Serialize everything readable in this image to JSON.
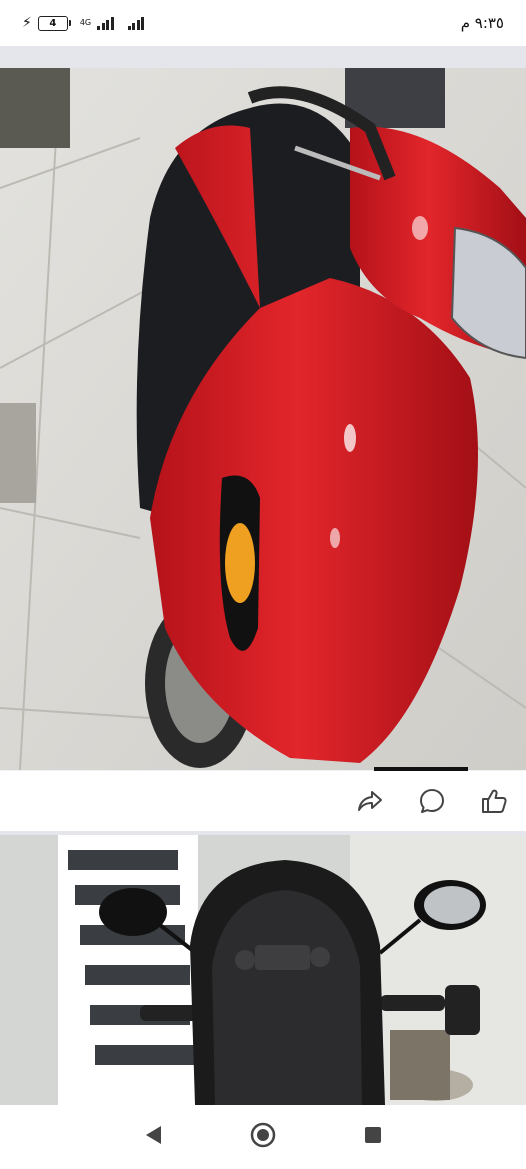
{
  "status_bar": {
    "time": "٩:٣٥ م",
    "battery_level": "4",
    "network": "4G"
  },
  "post": {
    "photos": [
      {
        "description_icon": "red-scooter-photo"
      },
      {
        "description_icon": "scooter-seat-photo"
      }
    ],
    "actions": [
      {
        "name": "share",
        "icon": "share-icon"
      },
      {
        "name": "comment",
        "icon": "comment-icon"
      },
      {
        "name": "like",
        "icon": "like-icon"
      }
    ]
  },
  "nav": {
    "back": "back-icon",
    "home": "home-icon",
    "recents": "recents-icon"
  },
  "colors": {
    "accent_red": "#d81e22",
    "background": "#f0f2f5"
  }
}
